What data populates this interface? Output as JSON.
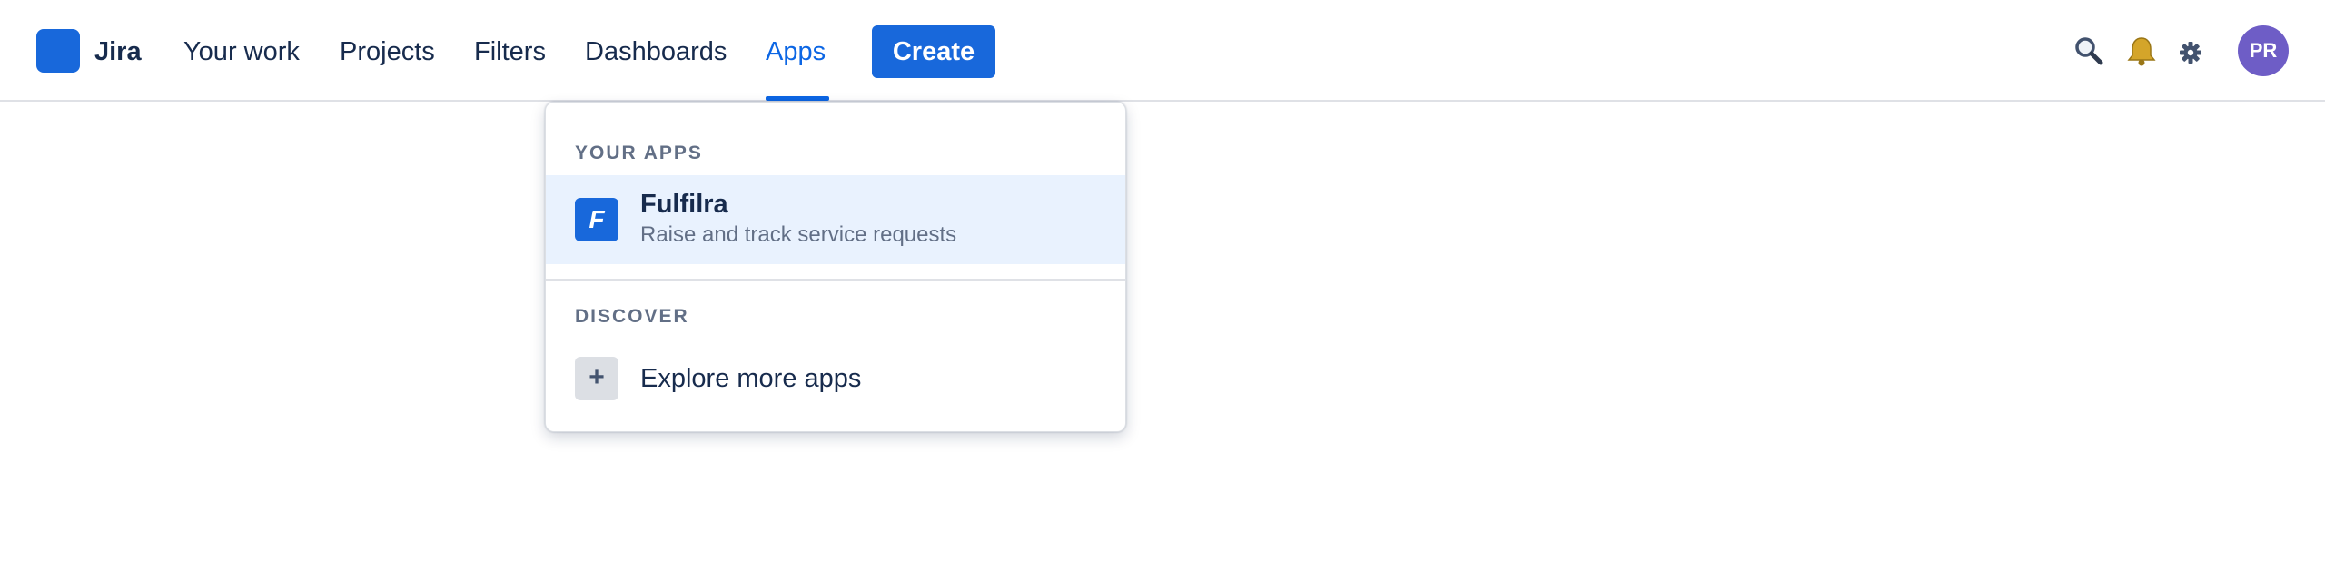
{
  "header": {
    "brand": "Jira",
    "nav": [
      {
        "label": "Your work"
      },
      {
        "label": "Projects"
      },
      {
        "label": "Filters"
      },
      {
        "label": "Dashboards"
      },
      {
        "label": "Apps",
        "active": true
      }
    ],
    "create_label": "Create",
    "icons": [
      "search-icon",
      "bell-icon",
      "gear-icon"
    ],
    "avatar_initials": "PR"
  },
  "apps_menu": {
    "your_apps_heading": "YOUR APPS",
    "apps": [
      {
        "tile_letter": "F",
        "name": "Fulfilra",
        "description": "Raise and track service requests"
      }
    ],
    "discover_heading": "DISCOVER",
    "explore_tile": "+",
    "explore_label": "Explore more apps"
  },
  "colors": {
    "brand": "#1868db",
    "active_nav": "#0c66e4",
    "highlight_row": "#e9f2fe",
    "avatar": "#6e5dc6",
    "bell": "#c9a227"
  }
}
